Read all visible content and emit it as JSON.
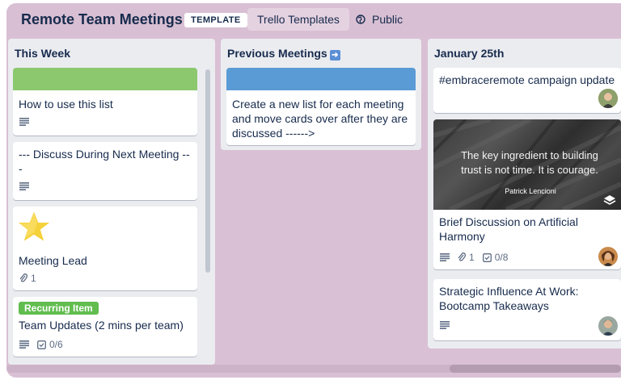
{
  "board": {
    "title": "Remote Team Meetings",
    "template_badge": "TEMPLATE",
    "workspace_button": "Trello Templates",
    "visibility_button": "Public"
  },
  "lists": [
    {
      "title": "This Week",
      "cards": [
        {
          "cover_color": "#8bc86e",
          "text": "How to use this list",
          "badges": {
            "description": true
          }
        },
        {
          "text": "--- Discuss During Next Meeting ---",
          "badges": {
            "description": true
          }
        },
        {
          "cover_icon": "star-icon",
          "text": "Meeting Lead",
          "badges": {
            "attachments": "1"
          }
        },
        {
          "label": "Recurring Item",
          "label_color": "#61bd4f",
          "text": "Team Updates (2 mins per team)",
          "badges": {
            "description": true,
            "checklist": "0/6"
          }
        }
      ]
    },
    {
      "title": "Previous Meetings",
      "title_emoji": "arrow-right-icon",
      "cards": [
        {
          "cover_color": "#5b9bd5",
          "text": "Create a new list for each meeting and move cards over after they are discussed ------>"
        }
      ]
    },
    {
      "title": "January 25th",
      "cards": [
        {
          "text": "#embraceremote campaign update",
          "avatar": "avatar-1"
        },
        {
          "cover_quote": "The key ingredient to building trust is not time. It is courage.",
          "cover_author": "Patrick Lencioni",
          "text": "Brief Discussion on Artificial Harmony",
          "badges": {
            "description": true,
            "attachments": "1",
            "checklist": "0/8"
          },
          "avatar": "avatar-2"
        },
        {
          "text": "Strategic Influence At Work: Bootcamp Takeaways",
          "badges": {
            "description": true
          },
          "avatar": "avatar-3"
        }
      ]
    }
  ]
}
